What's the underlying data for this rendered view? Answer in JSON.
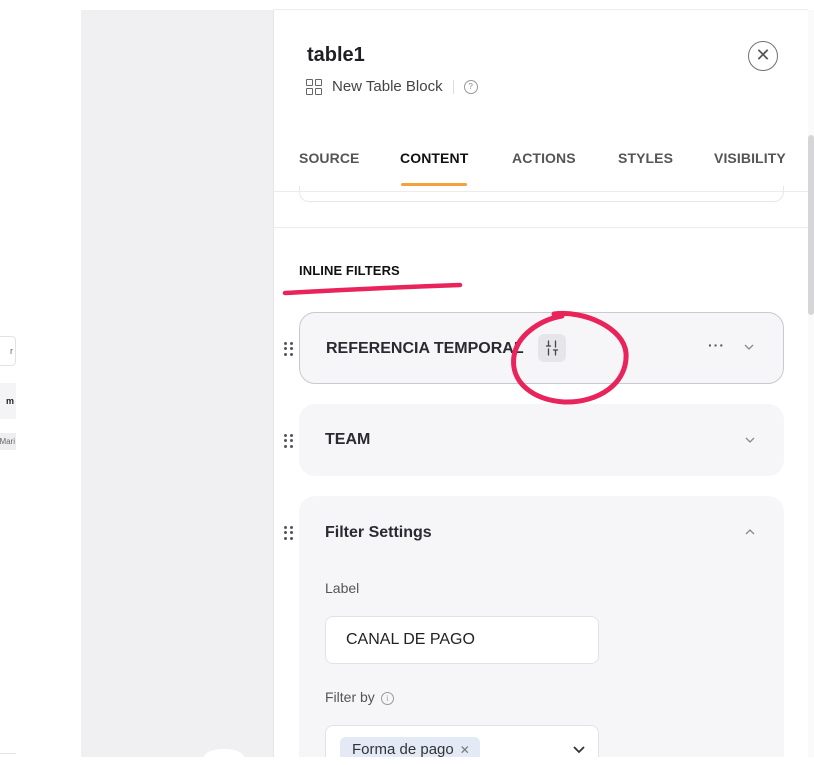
{
  "left_fragments": {
    "input_suffix": "r",
    "cell_suffix": "m",
    "tag_suffix": "Mari"
  },
  "block": {
    "title": "table1",
    "subtitle": "New Table Block"
  },
  "tabs": [
    {
      "label": "SOURCE",
      "active": false
    },
    {
      "label": "CONTENT",
      "active": true
    },
    {
      "label": "ACTIONS",
      "active": false
    },
    {
      "label": "STYLES",
      "active": false
    },
    {
      "label": "VISIBILITY",
      "active": false
    }
  ],
  "section": {
    "title": "INLINE FILTERS"
  },
  "filters": [
    {
      "title": "REFERENCIA TEMPORAL",
      "state": "collapsed",
      "has_sliders_icon": true,
      "has_more_menu": true
    },
    {
      "title": "TEAM",
      "state": "collapsed"
    },
    {
      "title": "Filter Settings",
      "state": "expanded"
    }
  ],
  "filter_settings": {
    "label_caption": "Label",
    "label_value": "CANAL DE PAGO",
    "filter_by_caption": "Filter by",
    "filter_by_value": "Forma de pago"
  },
  "colors": {
    "accent": "#f2a33a",
    "annotation": "#e8245a",
    "chip_bg": "#e3eaf5"
  },
  "icons": [
    "help-icon",
    "close-icon",
    "grid-icon",
    "drag-handle-icon",
    "sliders-icon",
    "more-icon",
    "chevron-down-icon",
    "chevron-up-icon",
    "info-icon",
    "remove-chip-icon"
  ]
}
